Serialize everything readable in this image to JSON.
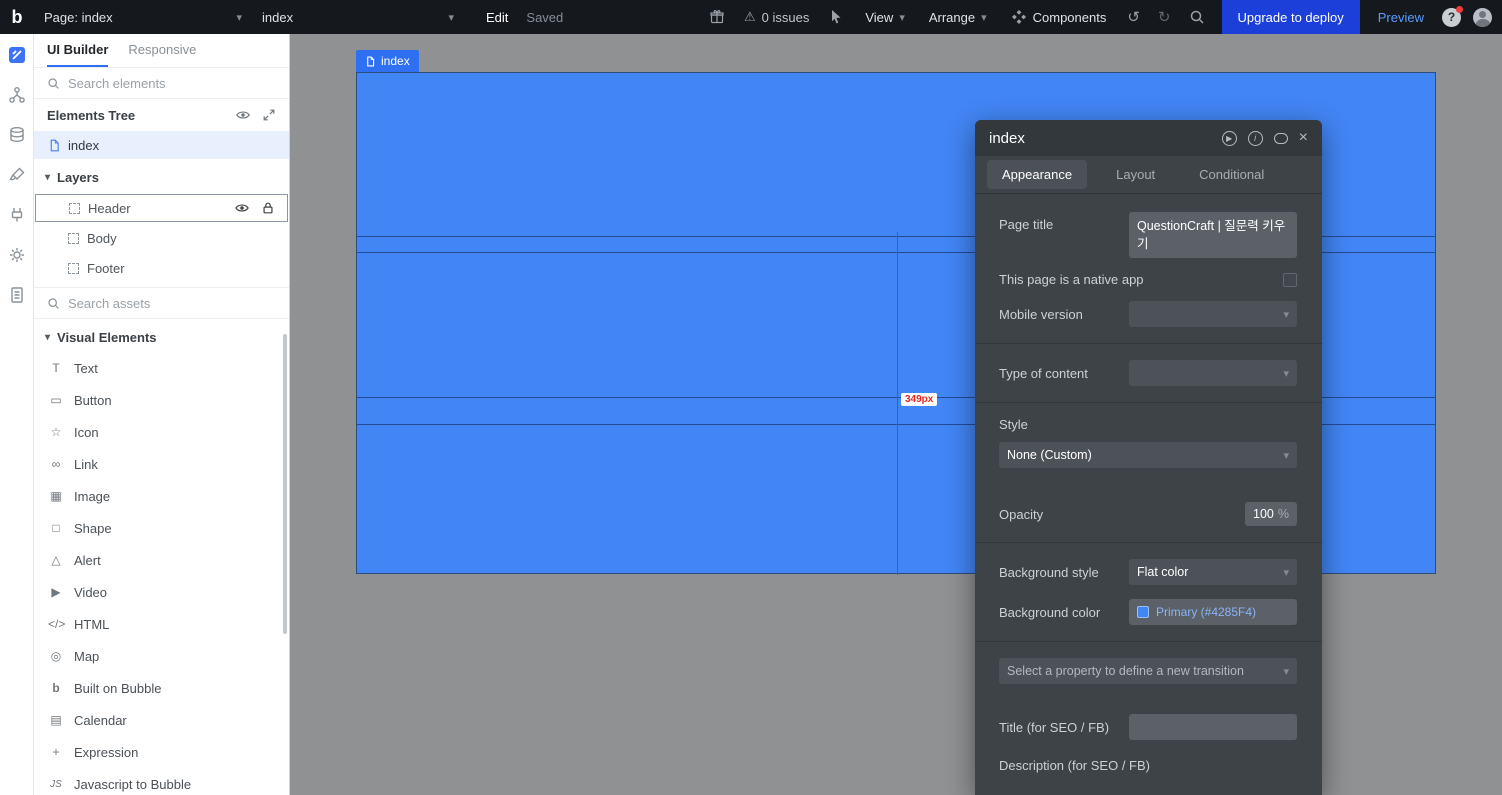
{
  "topbar": {
    "logo": "b",
    "page_selector": {
      "label": "Page: index"
    },
    "element_selector": {
      "label": "index"
    },
    "edit_label": "Edit",
    "saved_label": "Saved",
    "issues_label": "0 issues",
    "view_label": "View",
    "arrange_label": "Arrange",
    "components_label": "Components",
    "upgrade_button": "Upgrade to deploy",
    "preview_button": "Preview"
  },
  "left_panel": {
    "tabs": [
      {
        "label": "UI Builder"
      },
      {
        "label": "Responsive"
      }
    ],
    "search_elements": {
      "placeholder": "Search elements"
    },
    "elements_tree": {
      "title": "Elements Tree",
      "root": "index"
    },
    "layers": {
      "title": "Layers",
      "items": [
        {
          "label": "Header"
        },
        {
          "label": "Body"
        },
        {
          "label": "Footer"
        }
      ]
    },
    "search_assets": {
      "placeholder": "Search assets"
    },
    "visual_elements": {
      "title": "Visual Elements",
      "items": [
        {
          "label": "Text",
          "icon": "T"
        },
        {
          "label": "Button",
          "icon": "▭"
        },
        {
          "label": "Icon",
          "icon": "☆"
        },
        {
          "label": "Link",
          "icon": "∞"
        },
        {
          "label": "Image",
          "icon": "▦"
        },
        {
          "label": "Shape",
          "icon": "□"
        },
        {
          "label": "Alert",
          "icon": "△"
        },
        {
          "label": "Video",
          "icon": "▶"
        },
        {
          "label": "HTML",
          "icon": "</>"
        },
        {
          "label": "Map",
          "icon": "◎"
        },
        {
          "label": "Built on Bubble",
          "icon": "b"
        },
        {
          "label": "Calendar",
          "icon": "▤"
        },
        {
          "label": "Expression",
          "icon": "+"
        },
        {
          "label": "Javascript to Bubble",
          "icon": "JS"
        }
      ]
    }
  },
  "canvas": {
    "page_tab": "index",
    "measurement": "349px"
  },
  "inspector": {
    "title": "index",
    "tabs": [
      {
        "label": "Appearance"
      },
      {
        "label": "Layout"
      },
      {
        "label": "Conditional"
      }
    ],
    "page_title": {
      "label": "Page title",
      "value": "QuestionCraft | 질문력 키우기"
    },
    "native_app": {
      "label": "This page is a native app",
      "checked": false
    },
    "mobile_version": {
      "label": "Mobile version",
      "value": ""
    },
    "type_of_content": {
      "label": "Type of content",
      "value": ""
    },
    "style": {
      "label": "Style",
      "value": "None (Custom)"
    },
    "opacity": {
      "label": "Opacity",
      "value": "100",
      "unit": "%"
    },
    "background_style": {
      "label": "Background style",
      "value": "Flat color"
    },
    "background_color": {
      "label": "Background color",
      "value": "Primary (#4285F4)",
      "swatch": "#4285F4"
    },
    "transition": {
      "placeholder": "Select a property to define a new transition"
    },
    "seo_title": {
      "label": "Title (for SEO / FB)",
      "value": ""
    },
    "seo_description": {
      "label": "Description (for SEO / FB)"
    }
  },
  "colors": {
    "primary": "#4285F4",
    "canvas_bg": "#909193",
    "upgrade_blue": "#1d3fd9"
  }
}
